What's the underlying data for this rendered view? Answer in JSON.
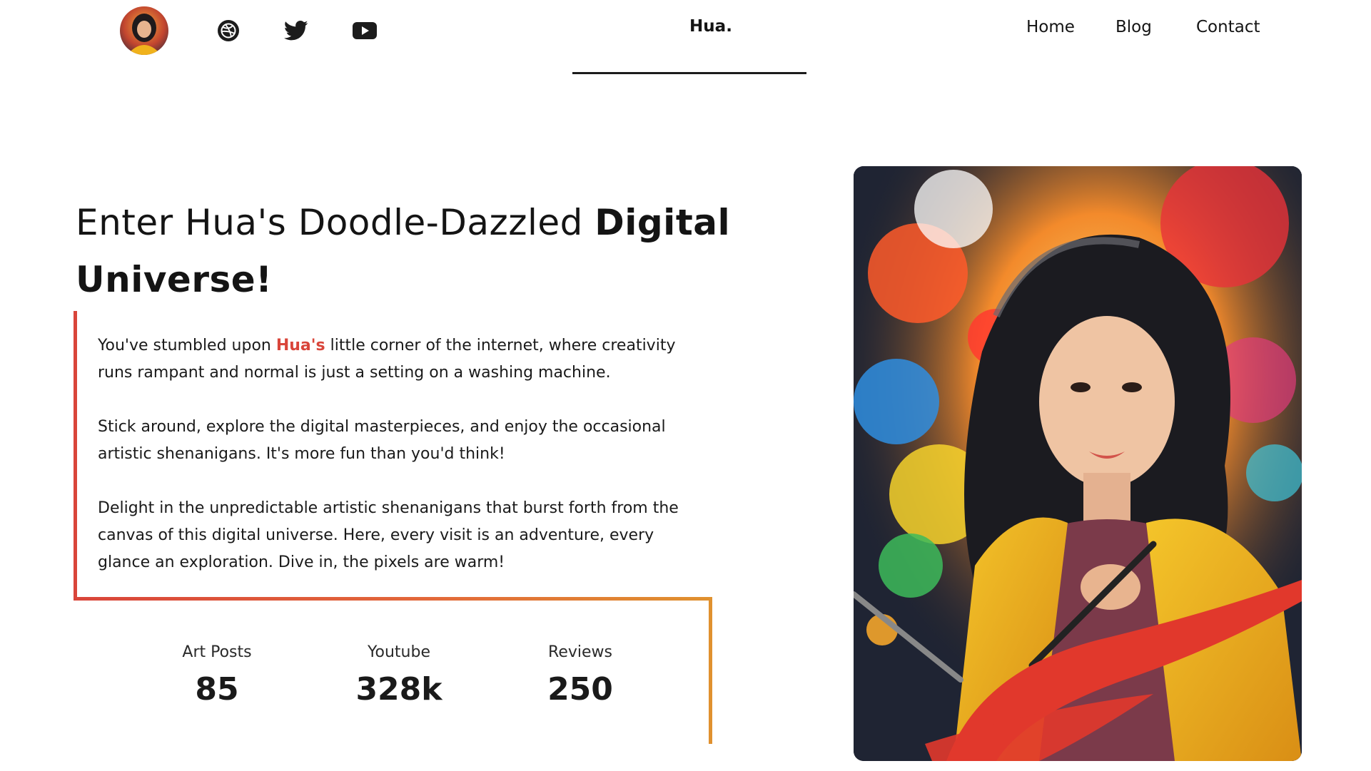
{
  "header": {
    "avatar": "profile-avatar",
    "social_icons": [
      "dribbble-icon",
      "twitter-icon",
      "youtube-icon"
    ],
    "brand": "Hua.",
    "nav": [
      {
        "label": "Home"
      },
      {
        "label": "Blog"
      },
      {
        "label": "Contact"
      }
    ]
  },
  "hero": {
    "title_light": "Enter Hua's Doodle-Dazzled ",
    "title_bold": "Digital Universe!",
    "p1_before": "You've stumbled upon ",
    "p1_highlight": "Hua's",
    "p1_after": " little corner of the internet, where creativity runs rampant and normal is just a setting on a washing machine.",
    "p2": "Stick around, explore the digital masterpieces, and enjoy the occasional artistic shenanigans. It's more fun than you'd think!",
    "p3": "Delight in the unpredictable artistic shenanigans that burst forth from the canvas of this digital universe. Here, every visit is an adventure, every glance an exploration. Dive in, the pixels are warm!"
  },
  "stats": [
    {
      "label": "Art Posts",
      "value": "85"
    },
    {
      "label": "Youtube",
      "value": "328k"
    },
    {
      "label": "Reviews",
      "value": "250"
    }
  ],
  "colors": {
    "accent": "#d9453a",
    "accent_orange": "#e0912f",
    "text": "#141414"
  }
}
